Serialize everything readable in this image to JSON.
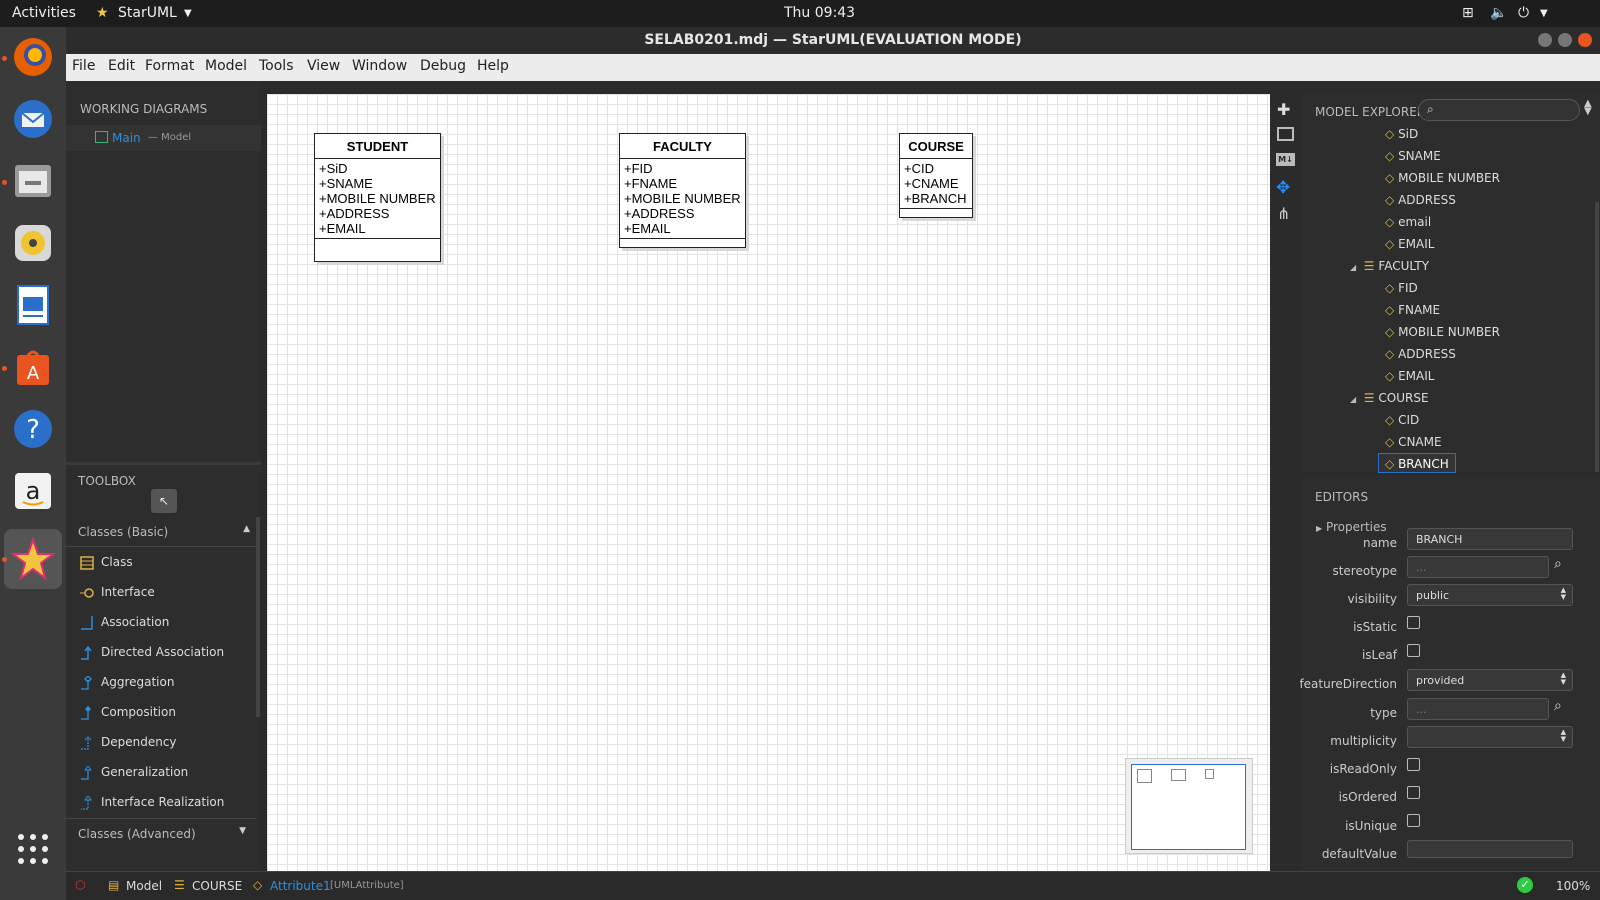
{
  "topbar": {
    "activities": "Activities",
    "app": "StarUML",
    "clock": "Thu 09:43"
  },
  "window": {
    "title": "SELAB0201.mdj — StarUML(EVALUATION MODE)"
  },
  "menu": [
    "File",
    "Edit",
    "Format",
    "Model",
    "Tools",
    "View",
    "Window",
    "Debug",
    "Help"
  ],
  "working_diagrams": {
    "title": "WORKING DIAGRAMS",
    "item": "Main",
    "item_sub": "— Model"
  },
  "toolbox": {
    "title": "TOOLBOX",
    "group1": "Classes (Basic)",
    "items": [
      "Class",
      "Interface",
      "Association",
      "Directed Association",
      "Aggregation",
      "Composition",
      "Dependency",
      "Generalization",
      "Interface Realization"
    ],
    "group2": "Classes (Advanced)"
  },
  "diagram": {
    "classes": [
      {
        "name": "STUDENT",
        "attrs": [
          "+SiD",
          "+SNAME",
          "+MOBILE NUMBER",
          "+ADDRESS",
          "+EMAIL"
        ]
      },
      {
        "name": "FACULTY",
        "attrs": [
          "+FID",
          "+FNAME",
          "+MOBILE NUMBER",
          "+ADDRESS",
          "+EMAIL"
        ]
      },
      {
        "name": "COURSE",
        "attrs": [
          "+CID",
          "+CNAME",
          "+BRANCH"
        ]
      }
    ]
  },
  "explorer": {
    "title": "MODEL EXPLORER",
    "items": [
      "SiD",
      "SNAME",
      "MOBILE NUMBER",
      "ADDRESS",
      "email",
      "EMAIL",
      "FACULTY",
      "FID",
      "FNAME",
      "MOBILE NUMBER",
      "ADDRESS",
      "EMAIL",
      "COURSE",
      "CID",
      "CNAME",
      "BRANCH"
    ]
  },
  "editors": {
    "title": "EDITORS",
    "section": "Properties",
    "labels": [
      "name",
      "stereotype",
      "visibility",
      "isStatic",
      "isLeaf",
      "featureDirection",
      "type",
      "multiplicity",
      "isReadOnly",
      "isOrdered",
      "isUnique",
      "defaultValue"
    ],
    "name": "BRANCH",
    "stereotype_ph": "...",
    "visibility": "public",
    "featureDirection": "provided",
    "type_ph": "..."
  },
  "status": {
    "model": "Model",
    "cls": "COURSE",
    "attr": "Attribute1",
    "attr_type": "[UMLAttribute]",
    "zoom": "100%"
  },
  "colors": {
    "accent": "#1e90ff",
    "brand": "#e95420",
    "selection": "#2a6fc9"
  }
}
